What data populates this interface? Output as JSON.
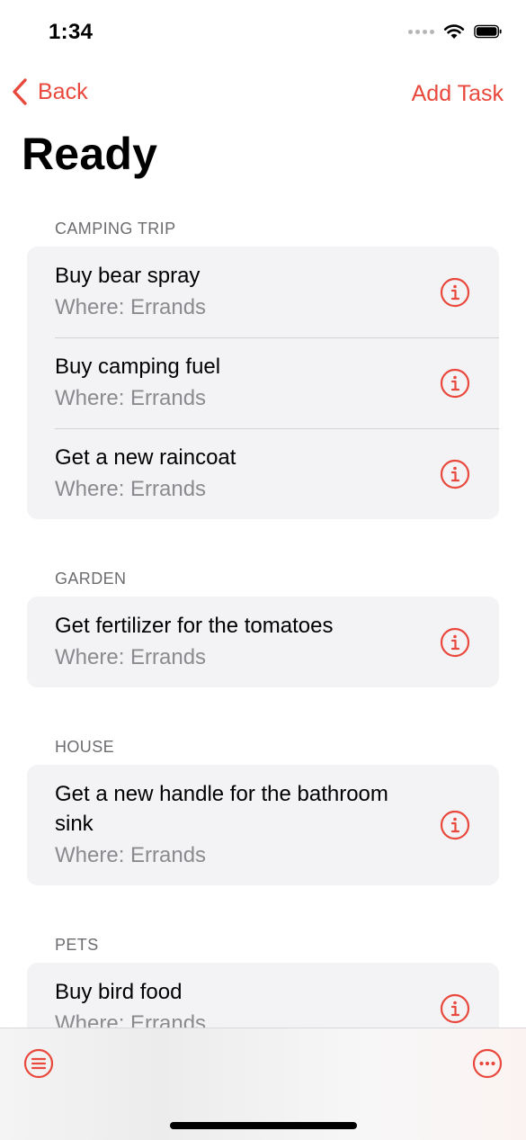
{
  "status_bar": {
    "time": "1:34"
  },
  "nav": {
    "back_label": "Back",
    "add_task_label": "Add Task"
  },
  "page_title": "Ready",
  "sections": [
    {
      "header": "CAMPING TRIP",
      "items": [
        {
          "title": "Buy bear spray",
          "subtitle": "Where: Errands"
        },
        {
          "title": "Buy camping fuel",
          "subtitle": "Where: Errands"
        },
        {
          "title": "Get a new raincoat",
          "subtitle": "Where: Errands"
        }
      ]
    },
    {
      "header": "GARDEN",
      "items": [
        {
          "title": "Get fertilizer for the tomatoes",
          "subtitle": "Where: Errands"
        }
      ]
    },
    {
      "header": "HOUSE",
      "items": [
        {
          "title": "Get a new handle for the bathroom sink",
          "subtitle": "Where: Errands"
        }
      ]
    },
    {
      "header": "PETS",
      "items": [
        {
          "title": "Buy bird food",
          "subtitle": "Where: Errands"
        }
      ]
    }
  ],
  "icons": {
    "back": "chevron-left-icon",
    "info": "info-circle-icon",
    "toolbar_left": "list-icon",
    "toolbar_right": "more-icon"
  },
  "colors": {
    "accent": "#e9483c",
    "cell_background": "#f3f2f4",
    "secondary_text": "#8b8a8e",
    "section_header": "#6c6c70"
  }
}
